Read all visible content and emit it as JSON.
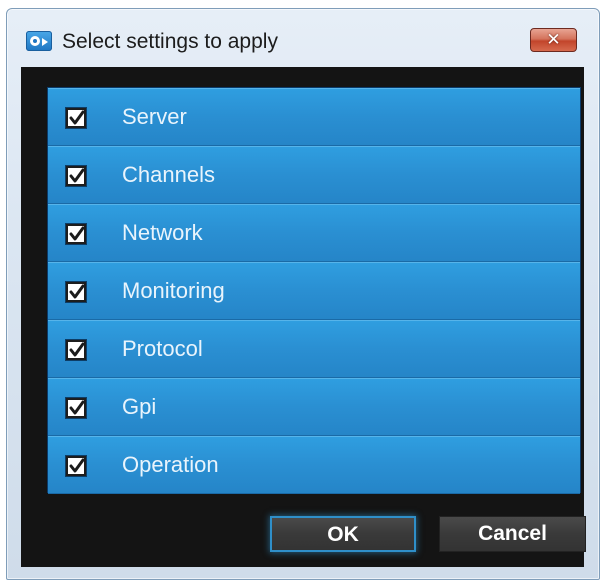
{
  "window": {
    "title": "Select settings to apply",
    "close_label": "✕"
  },
  "settings": {
    "items": [
      {
        "label": "Server",
        "checked": true
      },
      {
        "label": "Channels",
        "checked": true
      },
      {
        "label": "Network",
        "checked": true
      },
      {
        "label": "Monitoring",
        "checked": true
      },
      {
        "label": "Protocol",
        "checked": true
      },
      {
        "label": "Gpi",
        "checked": true
      },
      {
        "label": "Operation",
        "checked": true
      }
    ]
  },
  "buttons": {
    "ok_label": "OK",
    "cancel_label": "Cancel"
  },
  "colors": {
    "list_item": "#2a8fd2",
    "client_bg": "#141414",
    "focus_accent": "#2f8fc9",
    "close_button": "#c2452b"
  },
  "icons": {
    "app": "camera-icon",
    "close": "close-icon",
    "check": "checkmark-icon"
  }
}
